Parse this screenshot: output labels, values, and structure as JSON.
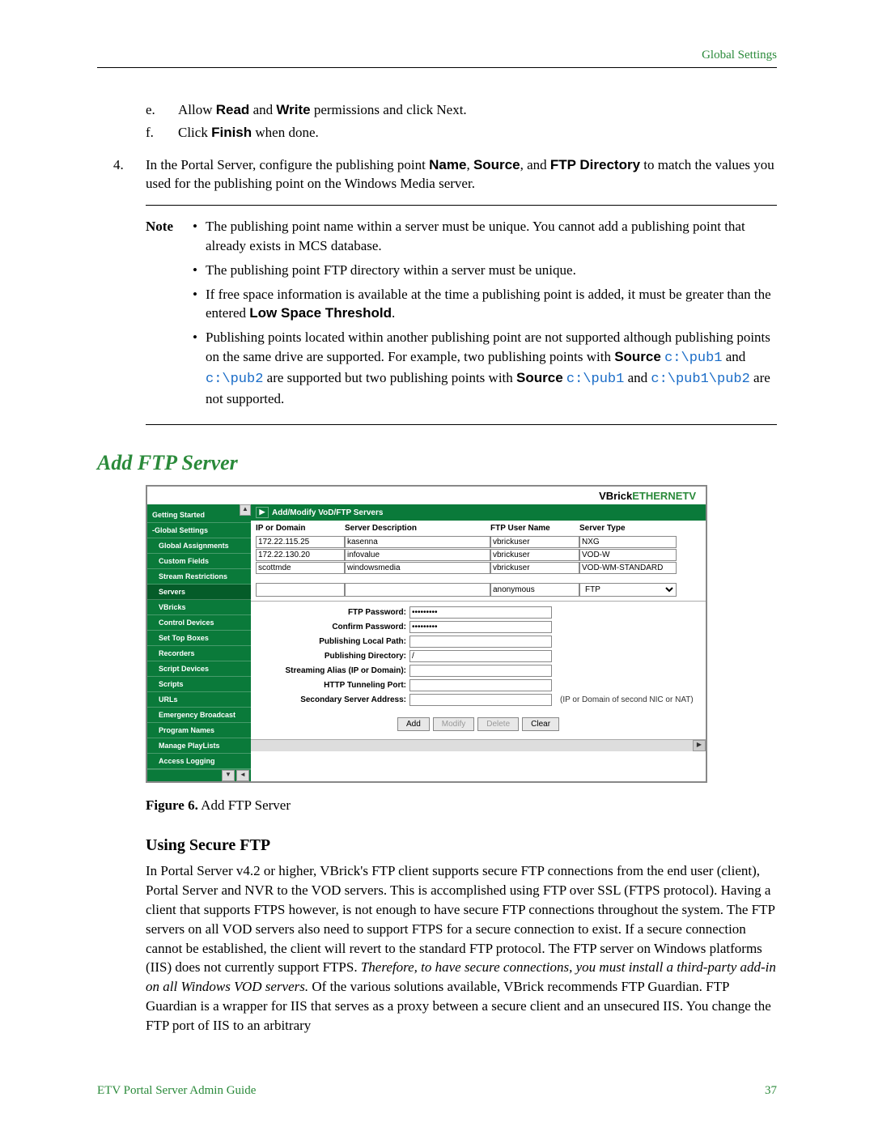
{
  "header_link": "Global Settings",
  "steps": {
    "e": "Allow Read and Write permissions and click Next.",
    "e_bold1": "Read",
    "e_bold2": "Write",
    "f": "Click Finish when done.",
    "f_bold": "Finish",
    "four": "In the Portal Server, configure the publishing point Name, Source, and FTP Directory to match the values you used for the publishing point on the Windows Media server.",
    "four_b1": "Name",
    "four_b2": "Source",
    "four_b3": "FTP Directory"
  },
  "note_label": "Note",
  "note_items": {
    "n1": "The publishing point name within a server must be unique. You cannot add a publishing point that already exists in MCS database.",
    "n2": "The publishing point FTP directory within a server must be unique.",
    "n3_a": "If free space information is available at the time a publishing point is added, it must be greater than the entered ",
    "n3_b": "Low Space Threshold",
    "n3_c": ".",
    "n4_a": "Publishing points located within another publishing point are not supported although publishing points on the same drive are supported. For example, two publishing points with ",
    "n4_b": "Source",
    "n4_path1": "c:\\pub1",
    "n4_mid": " and ",
    "n4_path2": "c:\\pub2",
    "n4_c": " are supported but two publishing points with ",
    "n4_b2": "Source",
    "n4_path3": "c:\\pub1",
    "n4_mid2": " and ",
    "n4_path4": "c:\\pub1\\pub2",
    "n4_d": " are not supported."
  },
  "h2": "Add FTP Server",
  "figure": {
    "logo_vb": "VBrick",
    "logo_et": "ETHERNETV",
    "panel_title": "Add/Modify VoD/FTP Servers",
    "headers": [
      "IP or Domain",
      "Server Description",
      "FTP User Name",
      "Server Type"
    ],
    "rows": [
      {
        "ip": "172.22.115.25",
        "desc": "kasenna",
        "user": "vbrickuser",
        "type": "NXG"
      },
      {
        "ip": "172.22.130.20",
        "desc": "infovalue",
        "user": "vbrickuser",
        "type": "VOD-W"
      },
      {
        "ip": "scottmde",
        "desc": "windowsmedia",
        "user": "vbrickuser",
        "type": "VOD-WM-STANDARD"
      }
    ],
    "new_row": {
      "ip": "",
      "desc": "",
      "user": "anonymous",
      "type": "FTP"
    },
    "form": {
      "ftp_password_label": "FTP Password:",
      "ftp_password_value": "•••••••••",
      "confirm_password_label": "Confirm Password:",
      "confirm_password_value": "•••••••••",
      "publishing_local_path_label": "Publishing Local Path:",
      "publishing_local_path_value": "",
      "publishing_directory_label": "Publishing Directory:",
      "publishing_directory_value": "/",
      "streaming_alias_label": "Streaming Alias (IP or Domain):",
      "streaming_alias_value": "",
      "http_tunneling_label": "HTTP Tunneling Port:",
      "http_tunneling_value": "",
      "secondary_server_label": "Secondary Server Address:",
      "secondary_server_value": "",
      "secondary_server_hint": "(IP or Domain of second NIC or NAT)"
    },
    "buttons": {
      "add": "Add",
      "modify": "Modify",
      "delete": "Delete",
      "clear": "Clear"
    },
    "sidebar": [
      "Getting Started",
      "-Global Settings",
      "Global Assignments",
      "Custom Fields",
      "Stream Restrictions",
      "Servers",
      "VBricks",
      "Control Devices",
      "Set Top Boxes",
      "Recorders",
      "Script Devices",
      "Scripts",
      "URLs",
      "Emergency Broadcast",
      "Program Names",
      "Manage PlayLists",
      "Access Logging"
    ]
  },
  "figcap_bold": "Figure 6.",
  "figcap_text": "  Add FTP Server",
  "h3": "Using Secure FTP",
  "para": {
    "a": "In Portal Server v4.2 or higher, VBrick's FTP client supports secure FTP connections from the end user (client), Portal Server and NVR to the VOD servers. This is accomplished using FTP over SSL (FTPS protocol). Having a client that supports FTPS however, is not enough to have secure FTP connections throughout the system. The FTP servers on all VOD servers also need to support FTPS for a secure connection to exist. If a secure connection cannot be established, the client will revert to the standard FTP protocol. The FTP server on Windows platforms (IIS) does not currently support FTPS. ",
    "b": "Therefore, to have secure connections, you must install a third-party add-in on all Windows VOD servers.",
    "c": " Of the various solutions available, VBrick recommends FTP Guardian. FTP Guardian is a wrapper for IIS that serves as a proxy between a secure client and an unsecured IIS. You change the FTP port of IIS to an arbitrary"
  },
  "footer_left": "ETV Portal Server Admin Guide",
  "footer_right": "37"
}
